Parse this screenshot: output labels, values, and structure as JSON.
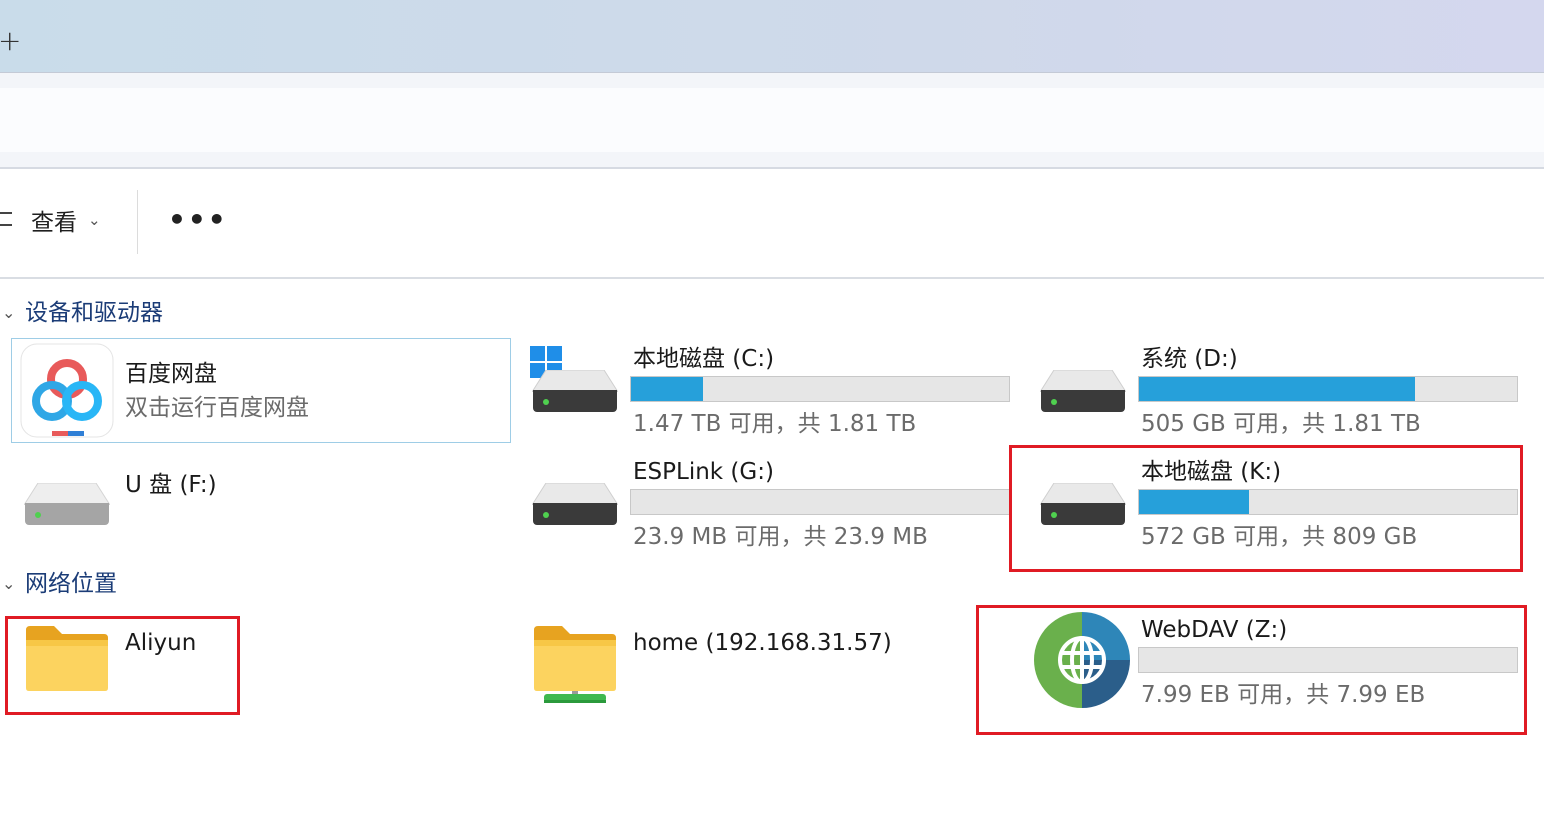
{
  "tabbar": {
    "new_tab": "+"
  },
  "toolbar": {
    "view_label": "查看",
    "view_chevron": "⌄",
    "more": "•••"
  },
  "groups": {
    "devices": {
      "chevron": "⌄",
      "title": "设备和驱动器"
    },
    "network": {
      "chevron": "⌄",
      "title": "网络位置"
    }
  },
  "items": {
    "baidu": {
      "name": "百度网盘",
      "subtitle": "双击运行百度网盘"
    },
    "c": {
      "name": "本地磁盘 (C:)",
      "free_text": "1.47 TB 可用，共 1.81 TB",
      "used_fraction": 0.19
    },
    "d": {
      "name": "系统 (D:)",
      "free_text": "505 GB 可用，共 1.81 TB",
      "used_fraction": 0.73
    },
    "f": {
      "name": "U 盘 (F:)"
    },
    "g": {
      "name": "ESPLink (G:)",
      "free_text": "23.9 MB 可用，共 23.9 MB",
      "used_fraction": 0.0
    },
    "k": {
      "name": "本地磁盘 (K:)",
      "free_text": "572 GB 可用，共 809 GB",
      "used_fraction": 0.29
    },
    "aliyun": {
      "name": "Aliyun"
    },
    "home": {
      "name": "home (192.168.31.57)"
    },
    "webdav": {
      "name": "WebDAV (Z:)",
      "free_text": "7.99 EB 可用，共 7.99 EB",
      "used_fraction": 0.0
    }
  },
  "colors": {
    "bar_fill": "#26a0da",
    "highlight": "#e01b24",
    "group_title": "#1b3c77"
  },
  "icons": {
    "drive": "hard-drive-icon",
    "windows": "windows-logo-icon",
    "baidu": "baidu-netdisk-icon",
    "folder": "folder-icon",
    "network_folder": "network-folder-icon",
    "webdav": "globe-icon"
  }
}
